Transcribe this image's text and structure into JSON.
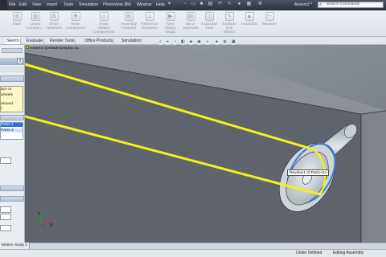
{
  "menu": {
    "items": [
      "File",
      "Edit",
      "View",
      "Insert",
      "Tools",
      "Simulation",
      "PhotoView 360",
      "Window",
      "Help"
    ],
    "pin_icon": "pin-icon"
  },
  "window": {
    "doc_title": "Assem3 *",
    "search_placeholder": "Search Commands"
  },
  "ribbon": {
    "buttons": [
      {
        "label": "Mate",
        "icon": "mate-icon"
      },
      {
        "label": "Linear\nCompon...",
        "icon": "linear-pattern-icon"
      },
      {
        "label": "Smart\nFasteners",
        "icon": "smart-fasteners-icon"
      },
      {
        "label": "Move\nComponent",
        "icon": "move-component-icon"
      },
      {
        "label": "Show\nHidden\nComponents",
        "icon": "show-hidden-icon"
      },
      {
        "label": "Assembly\nFeatures",
        "icon": "assembly-features-icon"
      },
      {
        "label": "Reference\nGeometry",
        "icon": "reference-geometry-icon"
      },
      {
        "label": "New\nMotion\nStudy",
        "icon": "motion-study-icon"
      },
      {
        "label": "Bill of\nMaterials",
        "icon": "bom-icon"
      },
      {
        "label": "Exploded\nView",
        "icon": "exploded-view-icon"
      },
      {
        "label": "Explode\nLine\nSketch",
        "icon": "explode-line-icon"
      },
      {
        "label": "Instant3D",
        "icon": "instant3d-icon"
      },
      {
        "label": "Measure",
        "icon": "measure-icon"
      }
    ]
  },
  "command_tabs": [
    "Sketch",
    "Evaluate",
    "Render Tools",
    "Office Products",
    "Simulation"
  ],
  "left_panel": {
    "help_button": "?",
    "message": [
      "ace or",
      "wheels",
      "",
      "around",
      "l."
    ],
    "selections": [
      "Part1-1",
      "Part1-2"
    ]
  },
  "viewport": {
    "breadcrumb": "Assem3  (Default<Display St...",
    "tooltip": "Revolve1 of Part1<2>"
  },
  "bottom_tabs": [
    "Motion Study 1"
  ],
  "status": {
    "left": "Under Defined",
    "right": "Editing Assembly"
  },
  "colors": {
    "belt": "#f2f218",
    "plate": "#5e636c",
    "selection": "#2f6fd6",
    "message_bg": "#fbf7c8"
  }
}
